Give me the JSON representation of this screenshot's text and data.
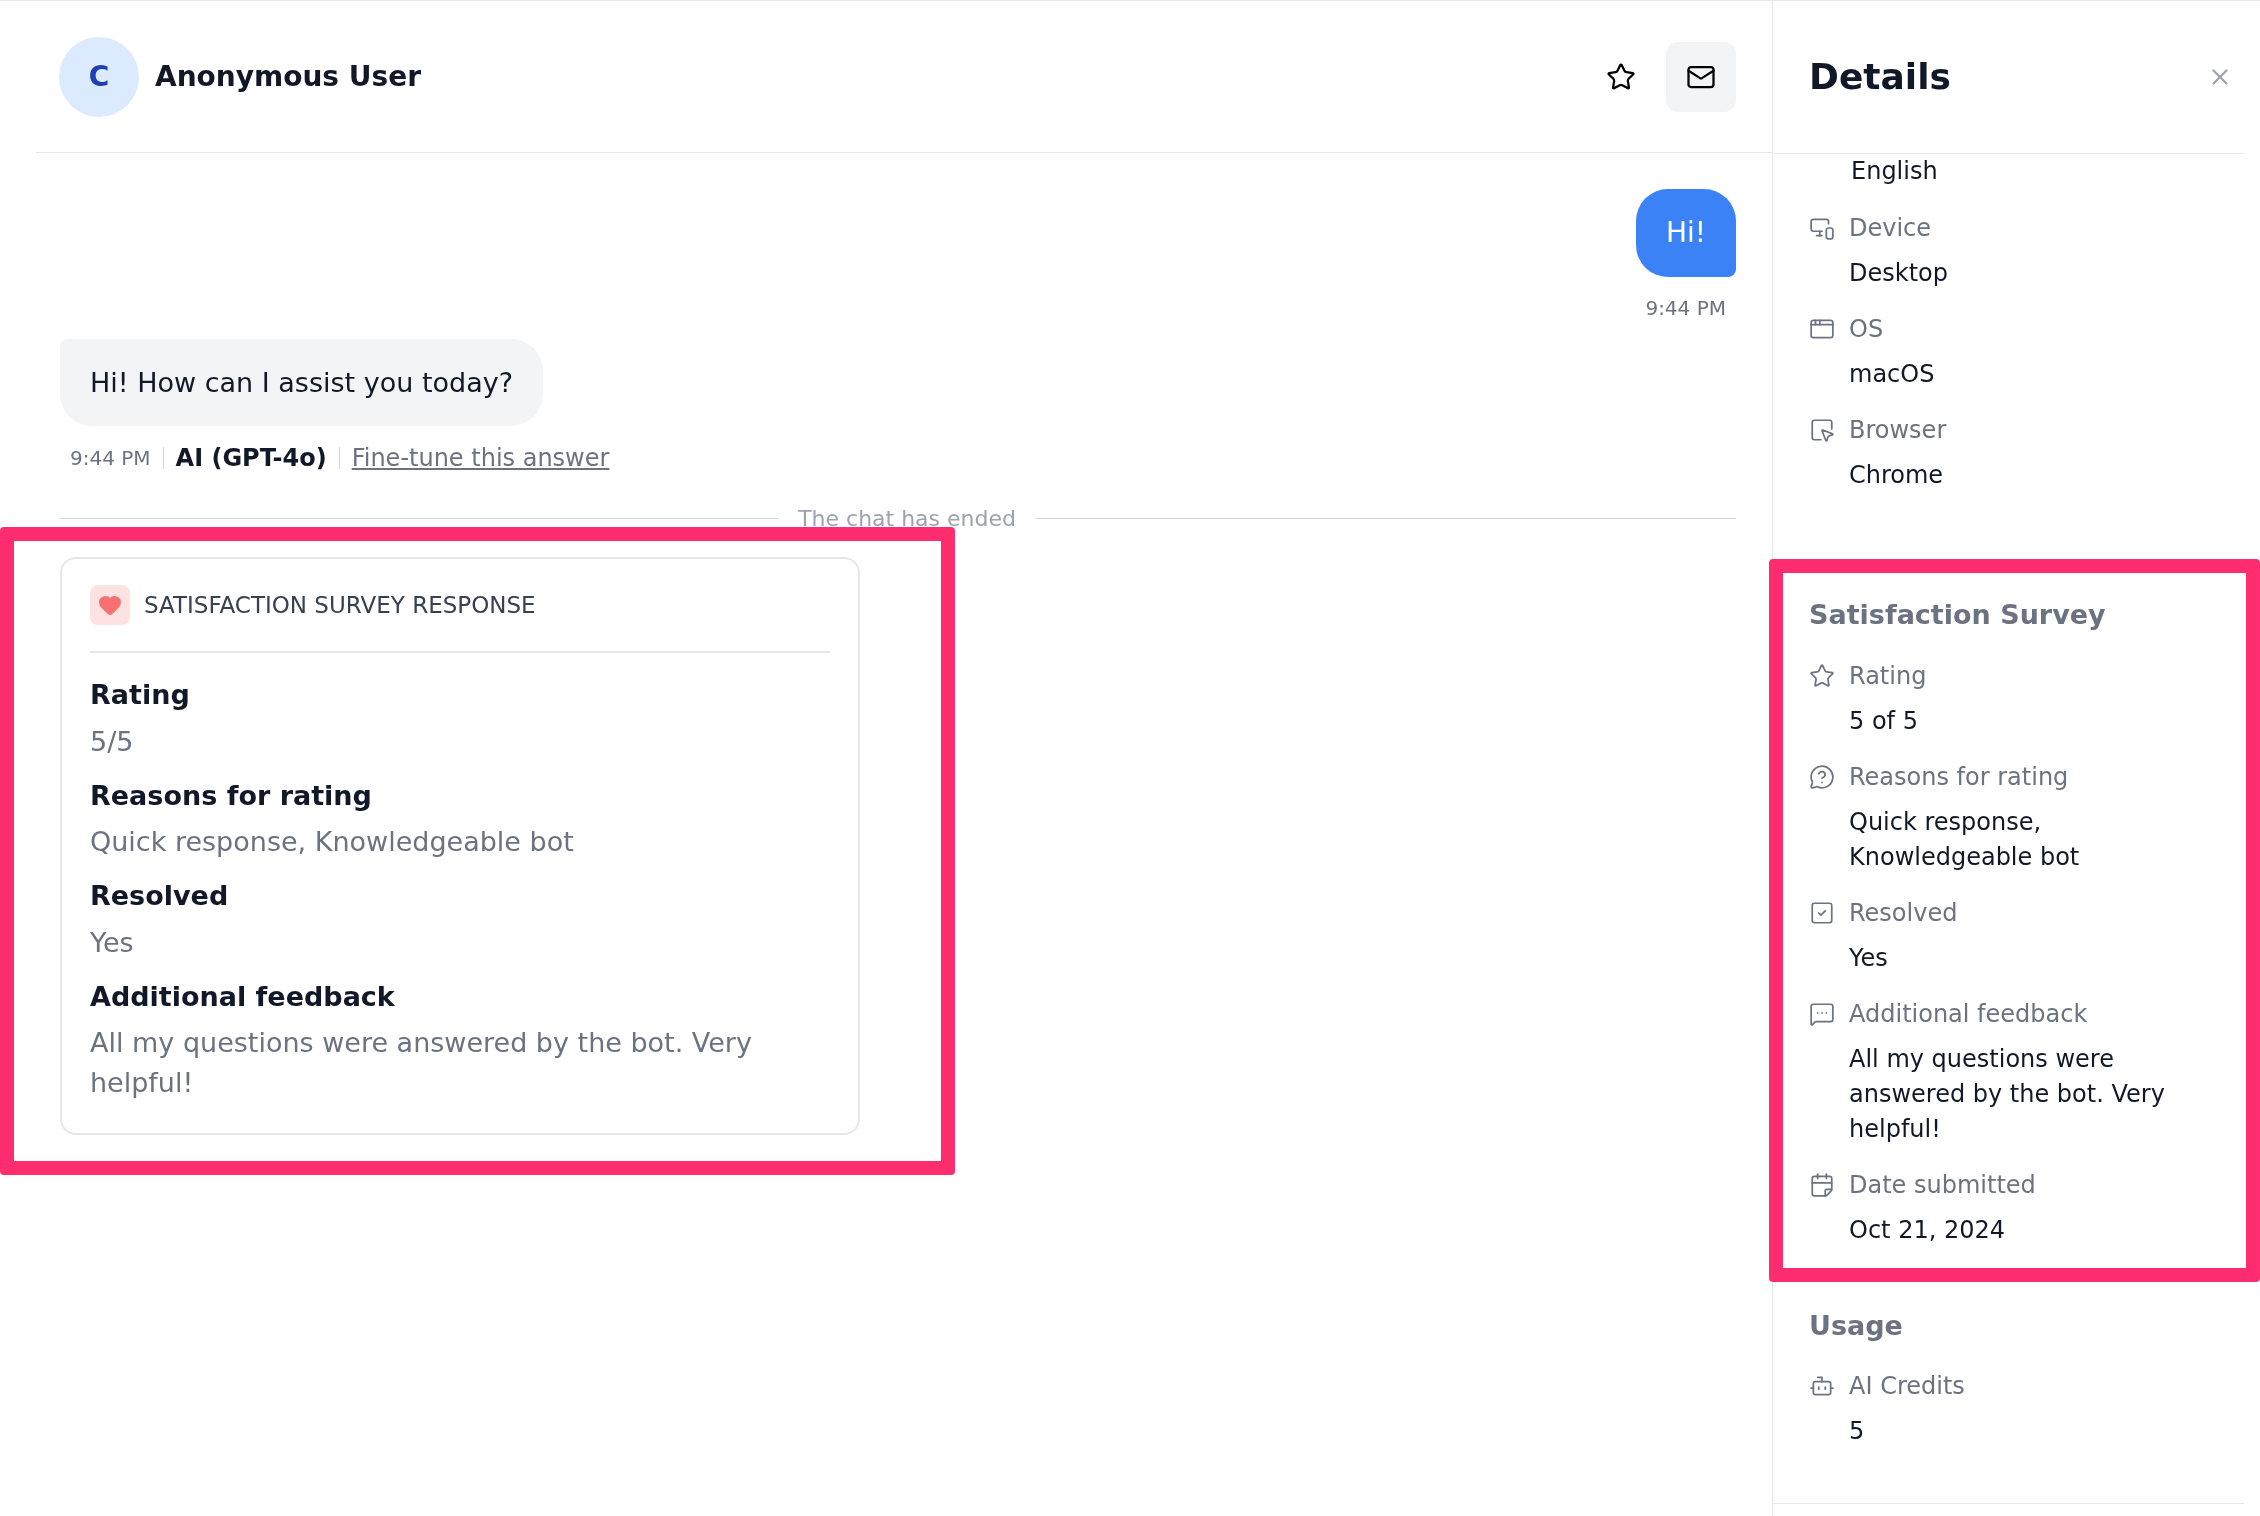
{
  "conversation": {
    "avatar_letter": "C",
    "user_name": "Anonymous User"
  },
  "messages": [
    {
      "kind": "user",
      "text": "Hi!",
      "time": "9:44 PM"
    },
    {
      "kind": "bot",
      "text": "Hi! How can I assist you today?",
      "time": "9:44 PM",
      "author": "AI (GPT-4o)",
      "link": "Fine-tune this answer"
    }
  ],
  "divider": "The chat has ended",
  "survey_card": {
    "highlighted": true,
    "title": "SATISFACTION SURVEY RESPONSE",
    "fields": [
      {
        "label": "Rating",
        "value": "5/5"
      },
      {
        "label": "Reasons for rating",
        "value": "Quick response, Knowledgeable bot"
      },
      {
        "label": "Resolved",
        "value": "Yes"
      },
      {
        "label": "Additional feedback",
        "value": "All my questions were answered by the bot. Very helpful!"
      }
    ]
  },
  "details": {
    "title": "Details",
    "cut_value": "English",
    "sections": [
      {
        "highlighted": false,
        "items": [
          {
            "kind": "device",
            "label": "Device",
            "value": "Desktop"
          },
          {
            "kind": "os",
            "label": "OS",
            "value": "macOS"
          },
          {
            "kind": "browser",
            "label": "Browser",
            "value": "Chrome"
          }
        ]
      },
      {
        "highlighted": true,
        "title": "Satisfaction Survey",
        "items": [
          {
            "kind": "rating",
            "label": "Rating",
            "value": "5 of 5"
          },
          {
            "kind": "reasons",
            "label": "Reasons for rating",
            "value": "Quick response, Knowledgeable bot"
          },
          {
            "kind": "resolved",
            "label": "Resolved",
            "value": "Yes"
          },
          {
            "kind": "feedback",
            "label": "Additional feedback",
            "value": "All my questions were answered by the bot. Very helpful!"
          },
          {
            "kind": "date",
            "label": "Date submitted",
            "value": "Oct 21, 2024"
          }
        ]
      },
      {
        "highlighted": false,
        "title": "Usage",
        "items": [
          {
            "kind": "credits",
            "label": "AI Credits",
            "value": "5"
          }
        ]
      }
    ]
  }
}
